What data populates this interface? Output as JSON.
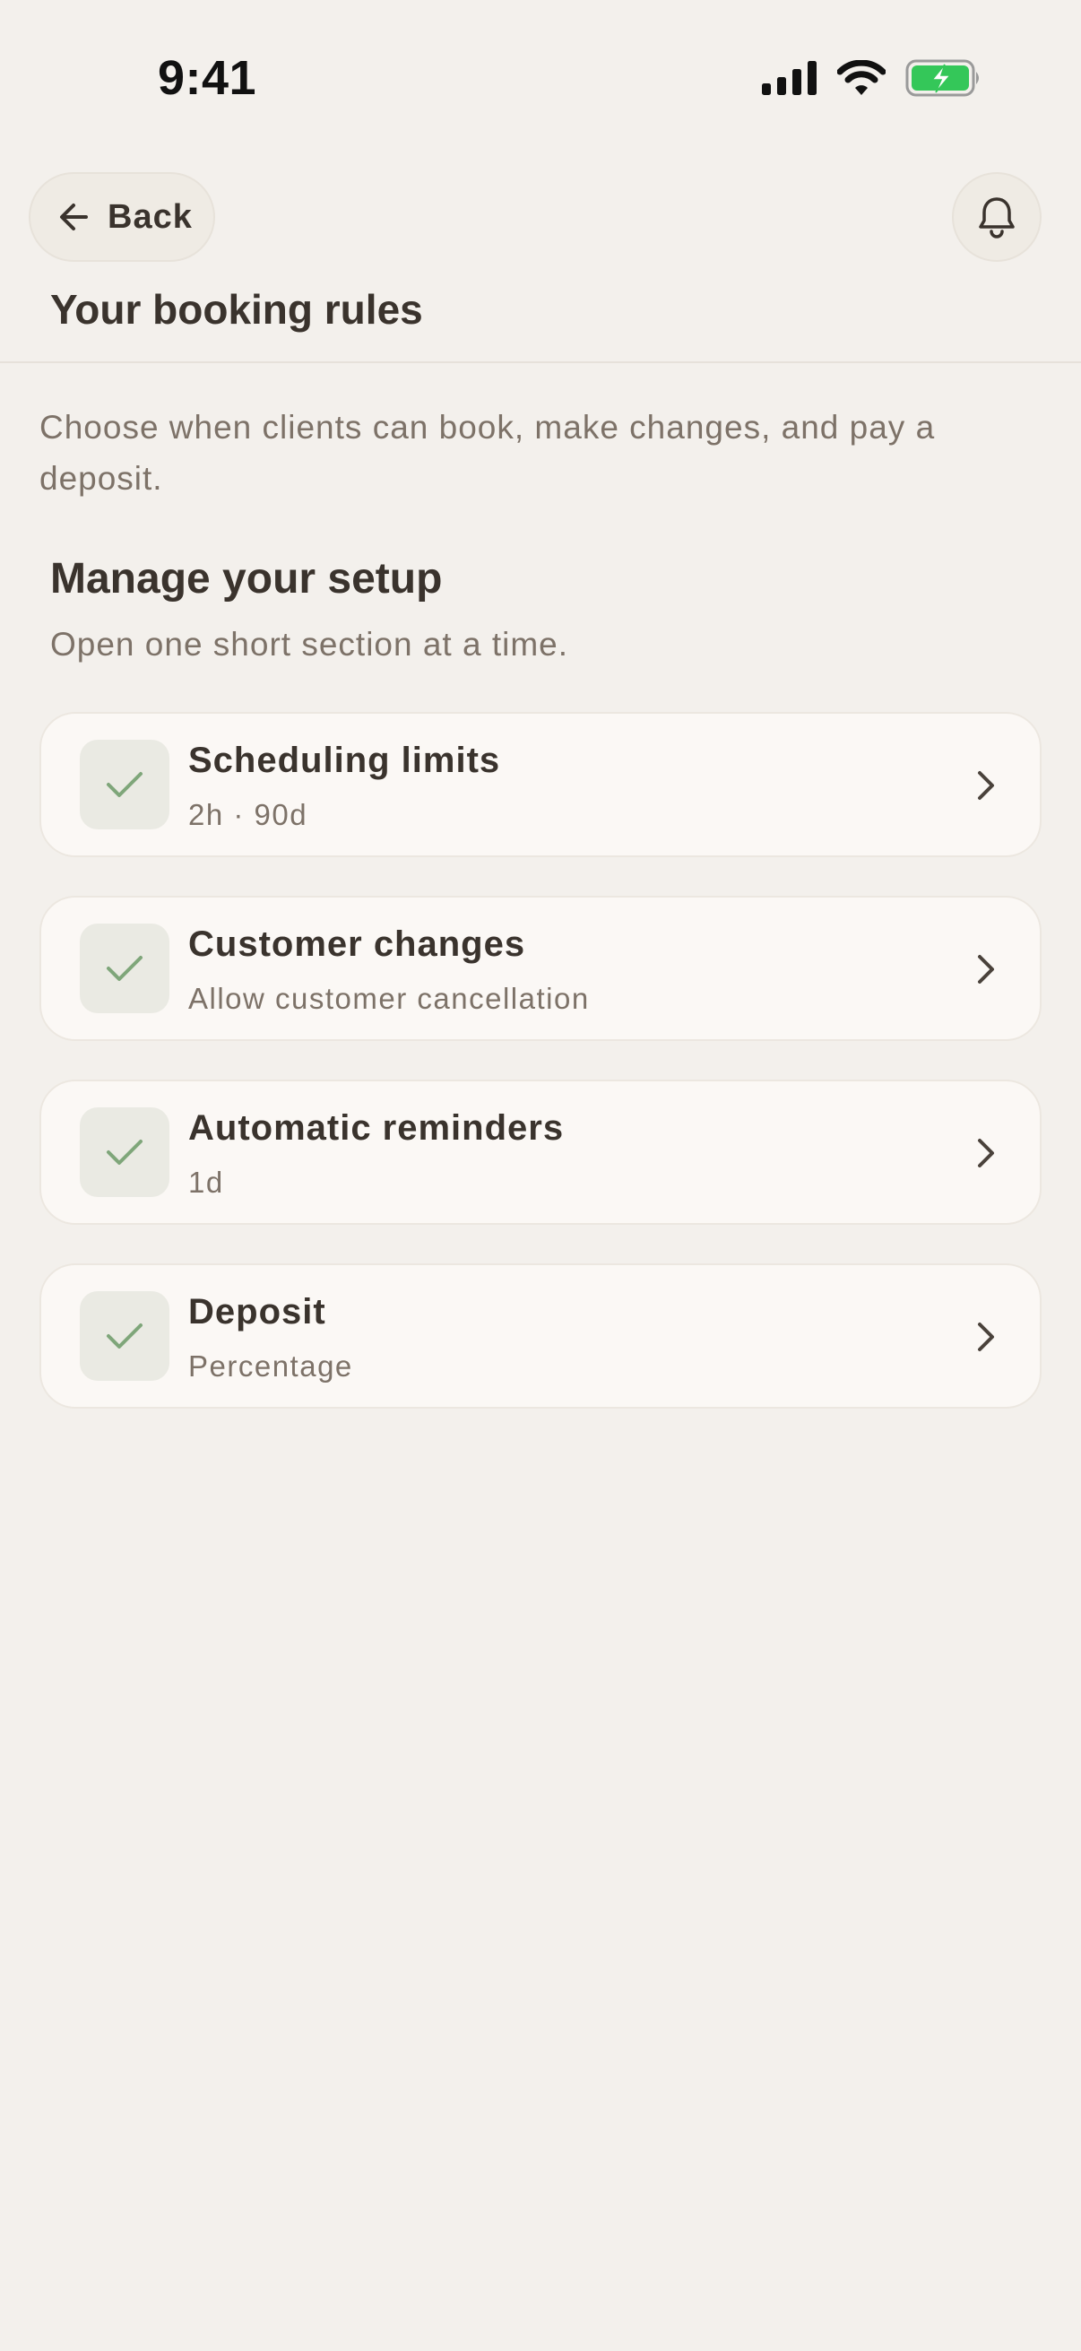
{
  "status_bar": {
    "time": "9:41",
    "icons": [
      "cellular-signal-icon",
      "wifi-icon",
      "battery-charging-icon"
    ],
    "battery_color": "#34c759"
  },
  "header": {
    "back_label": "Back",
    "back_icon": "arrow-left-icon",
    "notification_icon": "bell-icon",
    "title": "Your booking rules"
  },
  "intro": "Choose when clients can book, make changes, and pay a deposit.",
  "section": {
    "title": "Manage your setup",
    "subtitle": "Open one short section at a time."
  },
  "cards": [
    {
      "title": "Scheduling limits",
      "subtitle": "2h · 90d",
      "status": "complete"
    },
    {
      "title": "Customer changes",
      "subtitle": "Allow customer cancellation",
      "status": "complete"
    },
    {
      "title": "Automatic reminders",
      "subtitle": "1d",
      "status": "complete"
    },
    {
      "title": "Deposit",
      "subtitle": "Percentage",
      "status": "complete"
    }
  ],
  "colors": {
    "background": "#f3f0ec",
    "card": "#fbf8f5",
    "text_primary": "#3a332d",
    "text_secondary": "#7d7268",
    "check_accent": "#7fa67a"
  }
}
